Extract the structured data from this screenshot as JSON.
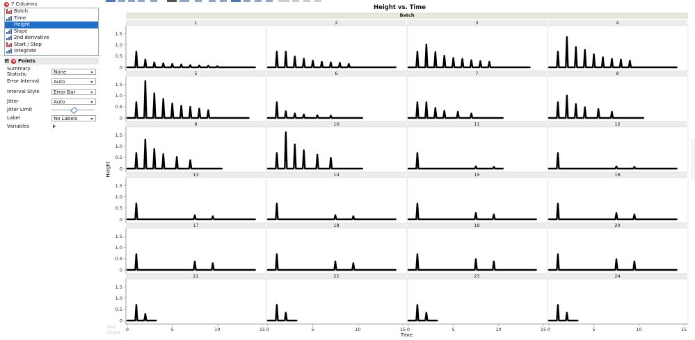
{
  "columns": {
    "header": "7 Columns",
    "items": [
      {
        "label": "Batch",
        "type": "nominal"
      },
      {
        "label": "Time",
        "type": "continuous"
      },
      {
        "label": "Height",
        "type": "continuous",
        "selected": true
      },
      {
        "label": "Slope",
        "type": "continuous"
      },
      {
        "label": "2nd derivative",
        "type": "continuous"
      },
      {
        "label": "Start / Stop",
        "type": "nominal"
      },
      {
        "label": "Integrate",
        "type": "continuous"
      }
    ]
  },
  "points_panel": {
    "title": "Points",
    "summary_statistic": {
      "label": "Summary Statistic",
      "value": "None"
    },
    "error_interval": {
      "label": "Error Interval",
      "value": "Auto"
    },
    "interval_style": {
      "label": "Interval Style",
      "value": "Error Bar"
    },
    "jitter": {
      "label": "Jitter",
      "value": "Auto"
    },
    "jitter_limit": {
      "label": "Jitter Limit",
      "level": 0.5
    },
    "label": {
      "label": "Label",
      "value": "No Labels"
    },
    "variables": {
      "label": "Variables"
    }
  },
  "ghost": {
    "map_shape": "Map\nShape"
  },
  "chart_data": {
    "type": "line",
    "title": "Height vs. Time",
    "facet_label": "Batch",
    "xlabel": "Time",
    "ylabel": "Height",
    "xlim": [
      0,
      15
    ],
    "ylim": [
      0,
      1.7
    ],
    "xticks": [
      0,
      5,
      10,
      15
    ],
    "yticks": [
      0,
      0.5,
      1,
      1.5
    ],
    "ytick_labels": [
      "0",
      "0.5",
      "1.0",
      "1.5"
    ],
    "grid": false,
    "panels": [
      {
        "batch": "1",
        "x_end": 14.2,
        "peaks": [
          {
            "x": 1,
            "y": 0.7
          },
          {
            "x": 2,
            "y": 0.35
          },
          {
            "x": 3,
            "y": 0.22
          },
          {
            "x": 4,
            "y": 0.18
          },
          {
            "x": 5,
            "y": 0.15
          },
          {
            "x": 6,
            "y": 0.13
          },
          {
            "x": 7,
            "y": 0.1
          },
          {
            "x": 8,
            "y": 0.08
          },
          {
            "x": 9,
            "y": 0.07
          },
          {
            "x": 10,
            "y": 0.05
          }
        ]
      },
      {
        "batch": "2",
        "x_end": 14.2,
        "peaks": [
          {
            "x": 1,
            "y": 0.7
          },
          {
            "x": 2,
            "y": 0.7
          },
          {
            "x": 3,
            "y": 0.48
          },
          {
            "x": 4,
            "y": 0.38
          },
          {
            "x": 5,
            "y": 0.3
          },
          {
            "x": 6,
            "y": 0.25
          },
          {
            "x": 7,
            "y": 0.22
          },
          {
            "x": 8,
            "y": 0.2
          },
          {
            "x": 9,
            "y": 0.15
          }
        ]
      },
      {
        "batch": "3",
        "x_end": 13.5,
        "peaks": [
          {
            "x": 1,
            "y": 0.7
          },
          {
            "x": 2,
            "y": 1.02
          },
          {
            "x": 3,
            "y": 0.68
          },
          {
            "x": 4,
            "y": 0.52
          },
          {
            "x": 5,
            "y": 0.42
          },
          {
            "x": 6,
            "y": 0.38
          },
          {
            "x": 7,
            "y": 0.32
          },
          {
            "x": 8,
            "y": 0.28
          },
          {
            "x": 9,
            "y": 0.25
          }
        ]
      },
      {
        "batch": "4",
        "x_end": 14.2,
        "peaks": [
          {
            "x": 1,
            "y": 0.7
          },
          {
            "x": 2,
            "y": 1.35
          },
          {
            "x": 3,
            "y": 0.9
          },
          {
            "x": 4,
            "y": 0.78
          },
          {
            "x": 5,
            "y": 0.58
          },
          {
            "x": 6,
            "y": 0.45
          },
          {
            "x": 7,
            "y": 0.38
          },
          {
            "x": 8,
            "y": 0.35
          },
          {
            "x": 9,
            "y": 0.3
          }
        ]
      },
      {
        "batch": "5",
        "x_end": 13.5,
        "peaks": [
          {
            "x": 1,
            "y": 0.7
          },
          {
            "x": 2,
            "y": 1.65
          },
          {
            "x": 3,
            "y": 1.1
          },
          {
            "x": 4,
            "y": 0.85
          },
          {
            "x": 5,
            "y": 0.65
          },
          {
            "x": 6,
            "y": 0.55
          },
          {
            "x": 7,
            "y": 0.5
          },
          {
            "x": 8,
            "y": 0.42
          },
          {
            "x": 9,
            "y": 0.35
          }
        ]
      },
      {
        "batch": "6",
        "x_end": 10.5,
        "peaks": [
          {
            "x": 1,
            "y": 0.7
          },
          {
            "x": 2,
            "y": 0.3
          },
          {
            "x": 3,
            "y": 0.2
          },
          {
            "x": 4,
            "y": 0.16
          },
          {
            "x": 5.5,
            "y": 0.12
          },
          {
            "x": 7,
            "y": 0.1
          }
        ]
      },
      {
        "batch": "7",
        "x_end": 10.5,
        "peaks": [
          {
            "x": 1,
            "y": 0.7
          },
          {
            "x": 2,
            "y": 0.7
          },
          {
            "x": 3,
            "y": 0.45
          },
          {
            "x": 4,
            "y": 0.32
          },
          {
            "x": 5.5,
            "y": 0.28
          },
          {
            "x": 7,
            "y": 0.2
          }
        ]
      },
      {
        "batch": "8",
        "x_end": 10.5,
        "peaks": [
          {
            "x": 1,
            "y": 0.7
          },
          {
            "x": 2,
            "y": 1.0
          },
          {
            "x": 3,
            "y": 0.62
          },
          {
            "x": 4,
            "y": 0.48
          },
          {
            "x": 5.5,
            "y": 0.4
          },
          {
            "x": 7,
            "y": 0.28
          }
        ]
      },
      {
        "batch": "9",
        "x_end": 10.5,
        "peaks": [
          {
            "x": 1,
            "y": 0.7
          },
          {
            "x": 2,
            "y": 1.3
          },
          {
            "x": 3,
            "y": 0.88
          },
          {
            "x": 4,
            "y": 0.65
          },
          {
            "x": 5.5,
            "y": 0.52
          },
          {
            "x": 7,
            "y": 0.38
          }
        ]
      },
      {
        "batch": "10",
        "x_end": 10.5,
        "peaks": [
          {
            "x": 1,
            "y": 0.7
          },
          {
            "x": 2,
            "y": 1.62
          },
          {
            "x": 3,
            "y": 1.08
          },
          {
            "x": 4,
            "y": 0.82
          },
          {
            "x": 5.5,
            "y": 0.62
          },
          {
            "x": 7,
            "y": 0.48
          }
        ]
      },
      {
        "batch": "11",
        "x_end": 10.5,
        "peaks": [
          {
            "x": 1,
            "y": 0.7
          },
          {
            "x": 7.5,
            "y": 0.1
          },
          {
            "x": 9.5,
            "y": 0.08
          }
        ]
      },
      {
        "batch": "12",
        "x_end": 14.2,
        "peaks": [
          {
            "x": 1,
            "y": 0.7
          },
          {
            "x": 7.5,
            "y": 0.1
          },
          {
            "x": 9.5,
            "y": 0.08
          }
        ]
      },
      {
        "batch": "13",
        "x_end": 14.2,
        "peaks": [
          {
            "x": 1,
            "y": 0.7
          },
          {
            "x": 7.5,
            "y": 0.18
          },
          {
            "x": 9.5,
            "y": 0.14
          }
        ]
      },
      {
        "batch": "14",
        "x_end": 14.2,
        "peaks": [
          {
            "x": 1,
            "y": 0.7
          },
          {
            "x": 7.5,
            "y": 0.18
          },
          {
            "x": 9.5,
            "y": 0.14
          }
        ]
      },
      {
        "batch": "15",
        "x_end": 14.2,
        "peaks": [
          {
            "x": 1,
            "y": 0.7
          },
          {
            "x": 7.5,
            "y": 0.28
          },
          {
            "x": 9.5,
            "y": 0.22
          }
        ]
      },
      {
        "batch": "16",
        "x_end": 14.2,
        "peaks": [
          {
            "x": 1,
            "y": 0.7
          },
          {
            "x": 7.5,
            "y": 0.28
          },
          {
            "x": 9.5,
            "y": 0.22
          }
        ]
      },
      {
        "batch": "17",
        "x_end": 14.2,
        "peaks": [
          {
            "x": 1,
            "y": 0.7
          },
          {
            "x": 7.5,
            "y": 0.38
          },
          {
            "x": 9.5,
            "y": 0.3
          }
        ]
      },
      {
        "batch": "18",
        "x_end": 14.2,
        "peaks": [
          {
            "x": 1,
            "y": 0.7
          },
          {
            "x": 7.5,
            "y": 0.38
          },
          {
            "x": 9.5,
            "y": 0.3
          }
        ]
      },
      {
        "batch": "19",
        "x_end": 14.2,
        "peaks": [
          {
            "x": 1,
            "y": 0.7
          },
          {
            "x": 7.5,
            "y": 0.48
          },
          {
            "x": 9.5,
            "y": 0.38
          }
        ]
      },
      {
        "batch": "20",
        "x_end": 14.2,
        "peaks": [
          {
            "x": 1,
            "y": 0.7
          },
          {
            "x": 7.5,
            "y": 0.48
          },
          {
            "x": 9.5,
            "y": 0.38
          }
        ]
      },
      {
        "batch": "21",
        "x_end": 3.2,
        "peaks": [
          {
            "x": 1,
            "y": 0.7
          },
          {
            "x": 2,
            "y": 0.3
          }
        ]
      },
      {
        "batch": "22",
        "x_end": 3.2,
        "peaks": [
          {
            "x": 1,
            "y": 0.7
          },
          {
            "x": 2,
            "y": 0.35
          }
        ]
      },
      {
        "batch": "23",
        "x_end": 3.2,
        "peaks": [
          {
            "x": 1,
            "y": 0.7
          },
          {
            "x": 2,
            "y": 0.35
          }
        ]
      },
      {
        "batch": "24",
        "x_end": 3.2,
        "peaks": [
          {
            "x": 1,
            "y": 0.7
          },
          {
            "x": 2,
            "y": 0.35
          }
        ]
      }
    ]
  }
}
